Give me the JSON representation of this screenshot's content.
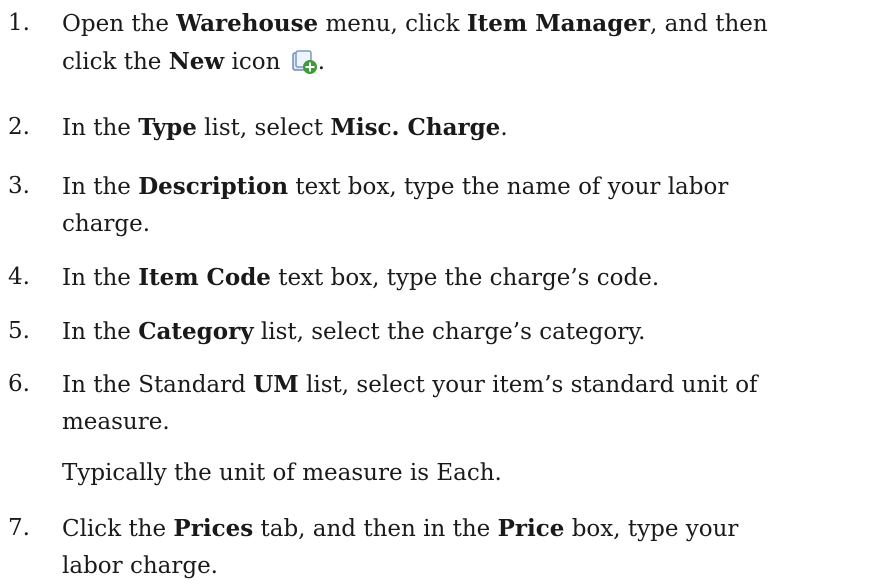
{
  "steps": [
    {
      "number": "1.",
      "lines": [
        [
          {
            "t": "Open the "
          },
          {
            "t": "Warehouse",
            "b": true
          },
          {
            "t": " menu, click "
          },
          {
            "t": "Item Manager",
            "b": true
          },
          {
            "t": ", and then"
          }
        ],
        [
          {
            "t": "click the "
          },
          {
            "t": "New",
            "b": true
          },
          {
            "t": " icon "
          },
          {
            "icon": "new-item-icon"
          },
          {
            "t": "."
          }
        ]
      ]
    },
    {
      "number": "2.",
      "lines": [
        [
          {
            "t": "In the "
          },
          {
            "t": "Type",
            "b": true
          },
          {
            "t": " list, select "
          },
          {
            "t": "Misc. Charge",
            "b": true
          },
          {
            "t": "."
          }
        ]
      ]
    },
    {
      "number": "3.",
      "lines": [
        [
          {
            "t": "In the "
          },
          {
            "t": "Description",
            "b": true
          },
          {
            "t": " text box, type the name of your labor"
          }
        ],
        [
          {
            "t": "charge."
          }
        ]
      ]
    },
    {
      "number": "4.",
      "lines": [
        [
          {
            "t": "In the "
          },
          {
            "t": "Item Code",
            "b": true
          },
          {
            "t": " text box, type the charge’s code."
          }
        ]
      ]
    },
    {
      "number": "5.",
      "lines": [
        [
          {
            "t": "In the "
          },
          {
            "t": "Category",
            "b": true
          },
          {
            "t": " list, select the charge’s category."
          }
        ]
      ]
    },
    {
      "number": "6.",
      "lines": [
        [
          {
            "t": "In the Standard "
          },
          {
            "t": "UM",
            "b": true
          },
          {
            "t": " list, select your item’s standard unit of"
          }
        ],
        [
          {
            "t": "measure."
          }
        ]
      ],
      "note": "Typically the unit of measure is Each."
    },
    {
      "number": "7.",
      "lines": [
        [
          {
            "t": "Click the "
          },
          {
            "t": "Prices",
            "b": true
          },
          {
            "t": " tab, and then in the "
          },
          {
            "t": "Price",
            "b": true
          },
          {
            "t": " box, type your"
          }
        ],
        [
          {
            "t": "labor charge."
          }
        ]
      ]
    }
  ]
}
